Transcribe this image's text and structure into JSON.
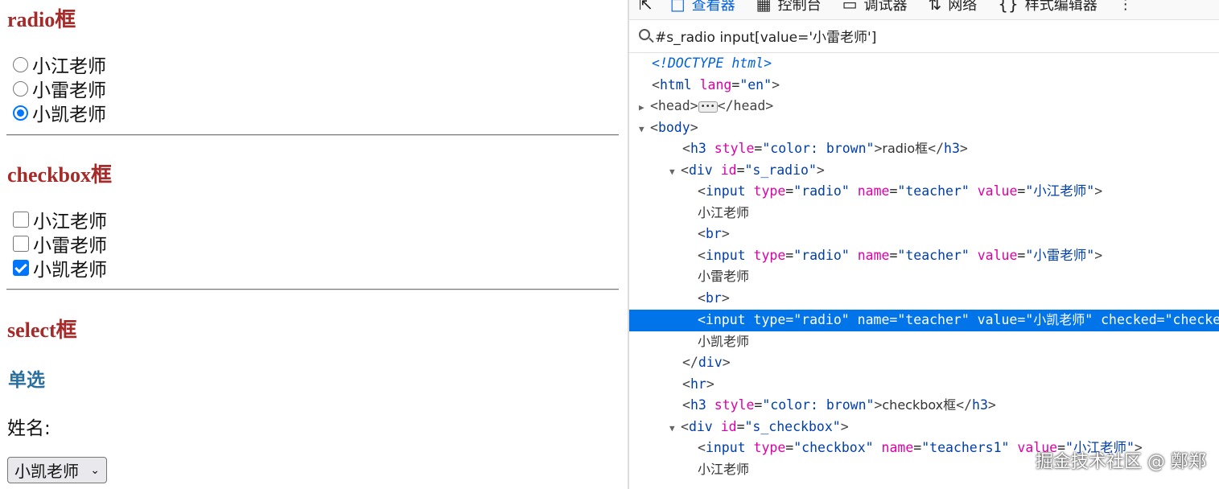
{
  "page": {
    "radio_heading": "radio框",
    "radio_options": [
      {
        "label": "小江老师",
        "checked": false
      },
      {
        "label": "小雷老师",
        "checked": false
      },
      {
        "label": "小凯老师",
        "checked": true
      }
    ],
    "checkbox_heading": "checkbox框",
    "checkbox_options": [
      {
        "label": "小江老师",
        "checked": false
      },
      {
        "label": "小雷老师",
        "checked": false
      },
      {
        "label": "小凯老师",
        "checked": true
      }
    ],
    "select_heading": "select框",
    "single_select_heading": "单选",
    "name_label": "姓名:",
    "select_value": "小凯老师",
    "heading_color": "#a52a2a",
    "accent_color": "#0075ff"
  },
  "devtools": {
    "tabs": [
      {
        "label": "查看器",
        "icon": "inspector-icon",
        "active": true
      },
      {
        "label": "控制台",
        "icon": "console-icon",
        "active": false
      },
      {
        "label": "调试器",
        "icon": "debugger-icon",
        "active": false
      },
      {
        "label": "网络",
        "icon": "network-icon",
        "active": false
      },
      {
        "label": "样式编辑器",
        "icon": "style-editor-icon",
        "active": false
      }
    ],
    "search_value": "#s_radio input[value='小雷老师']",
    "selected_color": "#0074e8"
  },
  "watermark": "掘金技术社区 @ 鄭郑"
}
